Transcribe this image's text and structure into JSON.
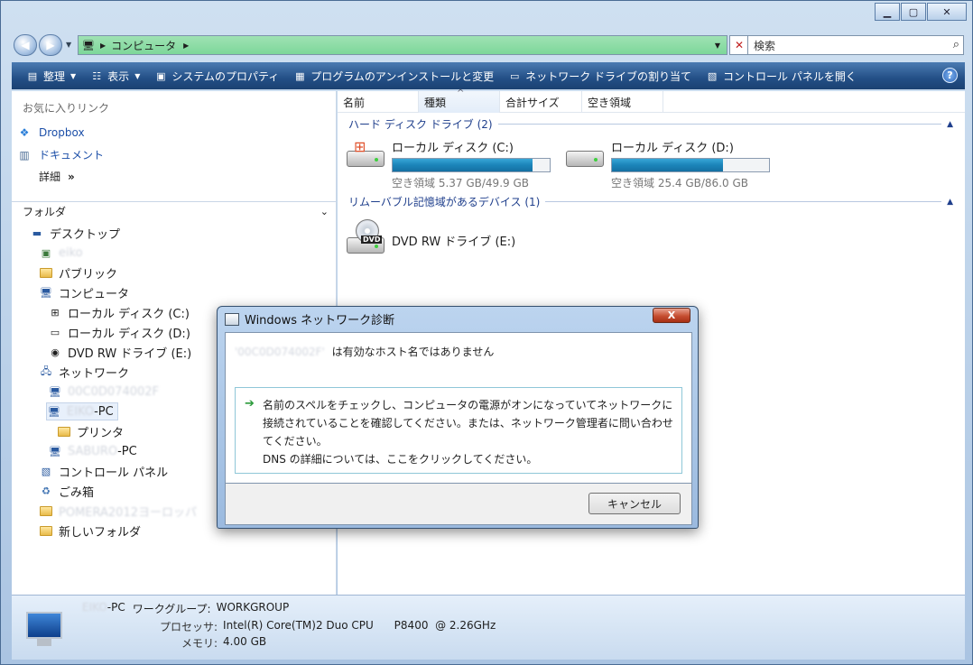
{
  "address": {
    "crumb": "コンピュータ",
    "search_placeholder": "検索"
  },
  "toolbar": {
    "items": [
      {
        "label": "整理",
        "icon": "organize-icon",
        "dropdown": true
      },
      {
        "label": "表示",
        "icon": "views-icon",
        "dropdown": true
      },
      {
        "label": "システムのプロパティ",
        "icon": "system-properties-icon"
      },
      {
        "label": "プログラムのアンインストールと変更",
        "icon": "uninstall-icon"
      },
      {
        "label": "ネットワーク ドライブの割り当て",
        "icon": "network-drive-icon"
      },
      {
        "label": "コントロール パネルを開く",
        "icon": "control-panel-icon"
      }
    ],
    "help": "?"
  },
  "sidebar": {
    "favorites_title": "お気に入りリンク",
    "favorites": [
      {
        "label": "Dropbox",
        "icon": "dropbox-icon"
      },
      {
        "label": "ドキュメント",
        "icon": "documents-icon"
      }
    ],
    "details_label": "詳細",
    "details_chevron": "»",
    "folders_title": "フォルダ",
    "tree": [
      {
        "label": "デスクトップ"
      },
      {
        "label": "eiko",
        "blurred": true
      },
      {
        "label": "パブリック"
      },
      {
        "label": "コンピュータ"
      },
      {
        "label": "ローカル ディスク (C:)"
      },
      {
        "label": "ローカル ディスク (D:)"
      },
      {
        "label": "DVD RW ドライブ (E:)"
      },
      {
        "label": "ネットワーク"
      },
      {
        "label": "00C0D074002F",
        "blurred": true
      },
      {
        "label": "EIKO",
        "suffix": "-PC"
      },
      {
        "label": "プリンタ"
      },
      {
        "label": "SABURO",
        "suffix": "-PC"
      },
      {
        "label": "コントロール パネル"
      },
      {
        "label": "ごみ箱"
      },
      {
        "label": "POMERA2012ヨーロッパ",
        "blurred": true
      },
      {
        "label": "新しいフォルダ"
      }
    ]
  },
  "columns": {
    "name": "名前",
    "type": "種類",
    "total": "合計サイズ",
    "free": "空き領域",
    "sort_indicator": "^"
  },
  "groups": {
    "hdd": "ハード ディスク ドライブ (2)",
    "removable": "リムーバブル記憶域があるデバイス (1)",
    "collapse": "▲"
  },
  "drives": [
    {
      "name": "ローカル ディスク (C:)",
      "free_text": "空き領域 5.37 GB/49.9 GB",
      "used_fraction": 0.892
    },
    {
      "name": "ローカル ディスク (D:)",
      "free_text": "空き領域 25.4 GB/86.0 GB",
      "used_fraction": 0.705
    }
  ],
  "dvd": {
    "name": "DVD RW ドライブ (E:)",
    "badge": "DVD"
  },
  "status": {
    "pc_name": "EIKO",
    "pc_suffix": "-PC",
    "workgroup_key": "ワークグループ:",
    "workgroup_val": "WORKGROUP",
    "cpu_key": "プロセッサ:",
    "cpu_val": "Intel(R) Core(TM)2 Duo CPU      P8400  @ 2.26GHz",
    "mem_key": "メモリ:",
    "mem_val": "4.00 GB"
  },
  "dialog": {
    "title": "Windows ネットワーク診断",
    "close": "X",
    "host_blurred": "'00C0D074002F'",
    "message": "は有効なホスト名ではありません",
    "arrow": "➔",
    "suggestion_1": "名前のスペルをチェックし、コンピュータの電源がオンになっていてネットワークに接続されていることを確認してください。または、ネットワーク管理者に問い合わせてください。",
    "suggestion_2": "DNS の詳細については、ここをクリックしてください。",
    "cancel": "キャンセル"
  }
}
